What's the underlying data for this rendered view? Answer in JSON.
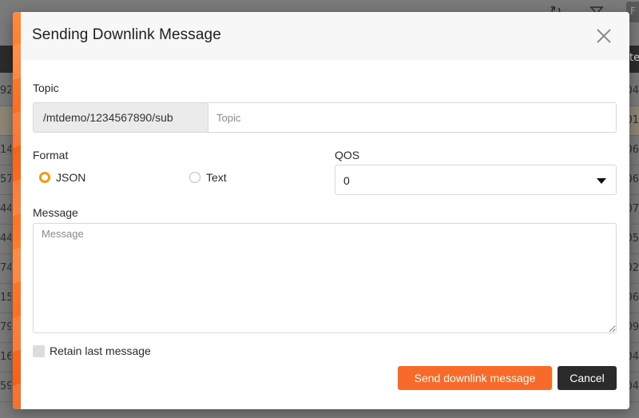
{
  "modal": {
    "title": "Sending Downlink Message",
    "topic": {
      "label": "Topic",
      "prefix": "/mtdemo/1234567890/sub",
      "placeholder": "Topic",
      "value": ""
    },
    "format": {
      "label": "Format",
      "options": [
        {
          "label": "JSON",
          "checked": true
        },
        {
          "label": "Text",
          "checked": false
        }
      ]
    },
    "qos": {
      "label": "QOS",
      "selected": "0"
    },
    "message": {
      "label": "Message",
      "placeholder": "Message",
      "value": ""
    },
    "retain": {
      "label": "Retain last message",
      "checked": false
    },
    "buttons": {
      "send": "Send downlink message",
      "cancel": "Cancel"
    }
  },
  "background": {
    "header_fragment": "te",
    "right_button": "F",
    "rows_left": [
      "92",
      "",
      "14",
      "57",
      "44",
      "44",
      "74",
      "15",
      "79",
      "16",
      "59"
    ],
    "rows_right": [
      "04",
      "01",
      "06",
      "06",
      "07",
      "05",
      "02",
      "06",
      "09",
      "04",
      "04"
    ]
  },
  "colors": {
    "accent": "#f76a2a",
    "radio_checked": "#f39a13",
    "cancel": "#2b2b2b"
  }
}
